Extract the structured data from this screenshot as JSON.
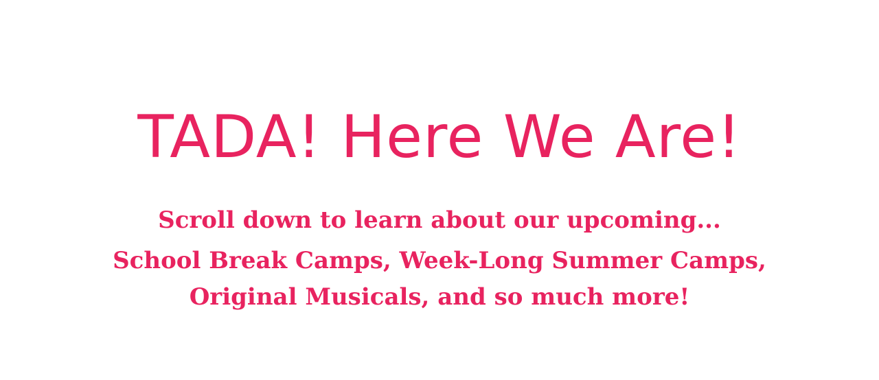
{
  "hero": {
    "title": "TADA! Here We Are!",
    "subtitle": "Scroll down to learn about our upcoming...",
    "details_line1": "School Break Camps, Week-Long Summer Camps,",
    "details_line2": "Original Musicals, and so much more!"
  },
  "colors": {
    "text_pink": "#e8235f",
    "background": "#ffffff"
  }
}
